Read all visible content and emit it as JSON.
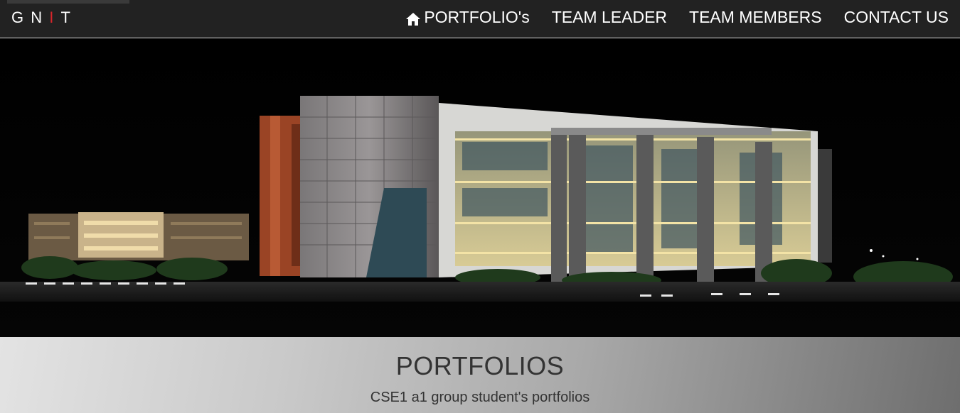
{
  "navbar": {
    "brand": {
      "letters": [
        "G",
        "N",
        "I",
        "T"
      ],
      "accent_color": "#d9262b"
    },
    "menu": [
      {
        "label": "PORTFOLIO's",
        "icon": "home-icon"
      },
      {
        "label": "TEAM LEADER"
      },
      {
        "label": "TEAM MEMBERS"
      },
      {
        "label": "CONTACT US"
      }
    ]
  },
  "hero": {
    "image": "college-building-night-photo"
  },
  "banner": {
    "title": "PORTFOLIOS",
    "subtitle": "CSE1 a1 group student's portfolios"
  }
}
